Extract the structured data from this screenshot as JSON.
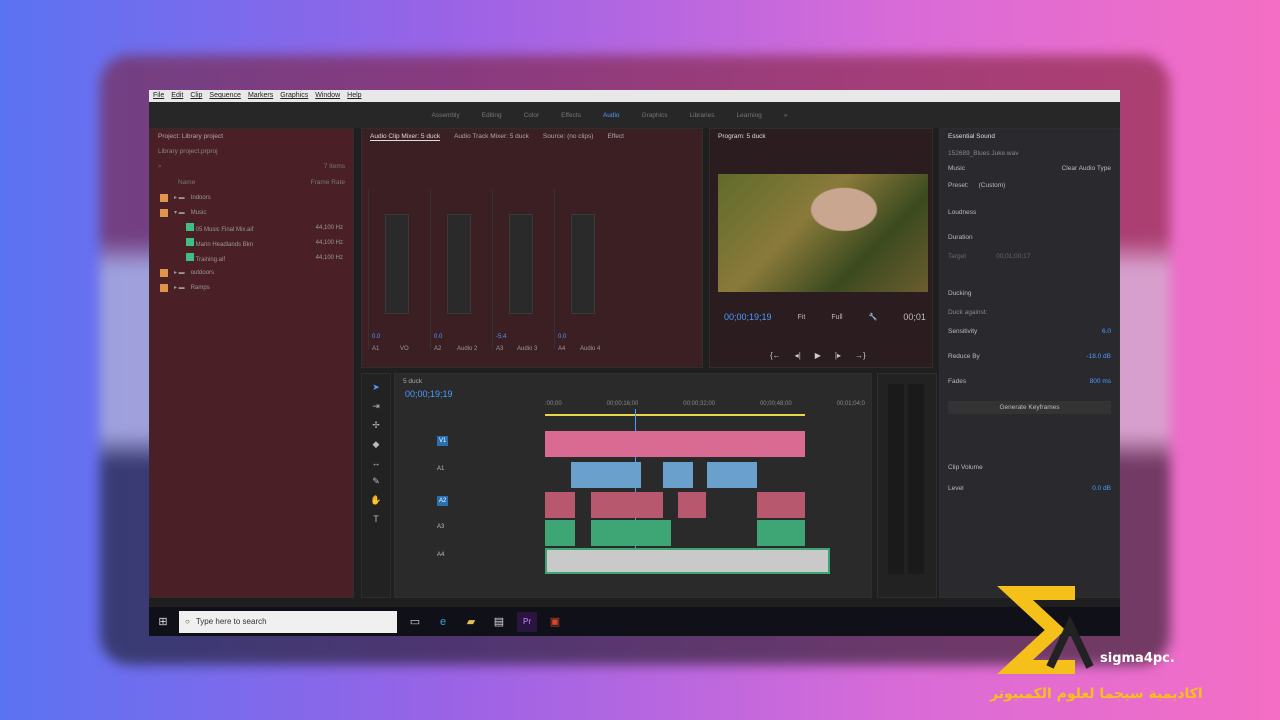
{
  "menu": [
    "File",
    "Edit",
    "Clip",
    "Sequence",
    "Markers",
    "Graphics",
    "Window",
    "Help"
  ],
  "workspaces": [
    "Assembly",
    "Editing",
    "Color",
    "Effects",
    "Audio",
    "Graphics",
    "Libraries",
    "Learning"
  ],
  "active_workspace": "Audio",
  "project": {
    "title": "Project: Library project",
    "file": "Library project.prproj",
    "items_count": "7 Items",
    "col_name": "Name",
    "col_rate": "Frame Rate",
    "rows": [
      {
        "name": "Indoors",
        "rate": ""
      },
      {
        "name": "Music",
        "rate": ""
      },
      {
        "name": "05 Music Final Mix.aif",
        "rate": "44,100 Hz"
      },
      {
        "name": "Marin Headlands Bkn",
        "rate": "44,100 Hz"
      },
      {
        "name": "Training.aif",
        "rate": "44,100 Hz"
      },
      {
        "name": "outdoors",
        "rate": ""
      },
      {
        "name": "Ramps",
        "rate": ""
      }
    ]
  },
  "mixer": {
    "tabs": [
      "Audio Clip Mixer: 5 duck",
      "Audio Track Mixer: 5 duck",
      "Source: (no clips)",
      "Effect"
    ],
    "channels": [
      {
        "id": "A1",
        "name": "VO",
        "val": "0.0"
      },
      {
        "id": "A2",
        "name": "Audio 2",
        "val": "0.0"
      },
      {
        "id": "A3",
        "name": "Audio 3",
        "val": "-5.4"
      },
      {
        "id": "A4",
        "name": "Audio 4",
        "val": "0.0"
      }
    ]
  },
  "program": {
    "title": "Program: 5 duck",
    "timecode": "00;00;19;19",
    "fit": "Fit",
    "quality": "Full",
    "end": "00;01"
  },
  "timeline": {
    "title": "5 duck",
    "timecode": "00;00;19;19",
    "ruler": [
      ":00;00",
      "00;00;16;00",
      "00;00;32;00",
      "00;00;48;00",
      "00;01;04;0"
    ],
    "tracks": [
      "V1",
      "A1",
      "A2",
      "A3",
      "A4"
    ]
  },
  "essential": {
    "title": "Essential Sound",
    "clip": "152689_Blues Juke.wav",
    "type": "Music",
    "clear": "Clear Audio Type",
    "preset_label": "Preset:",
    "preset": "(Custom)",
    "loudness": "Loudness",
    "duration": "Duration",
    "target": "Target",
    "target_val": "00;01;00;17",
    "ducking": "Ducking",
    "duck_against": "Duck against:",
    "sensitivity": "Sensitivity",
    "sens_val": "6.0",
    "reduce": "Reduce By",
    "reduce_val": "-18.0 dB",
    "fades": "Fades",
    "fades_val": "800 ms",
    "generate": "Generate Keyframes",
    "clip_volume": "Clip Volume",
    "level": "Level",
    "level_val": "0.0 dB"
  },
  "taskbar": {
    "search_placeholder": "Type here to search"
  },
  "brand": {
    "name": "sigma4pc.",
    "arabic": "اكاديمية سيجما لعلوم الكمبيوتر"
  }
}
